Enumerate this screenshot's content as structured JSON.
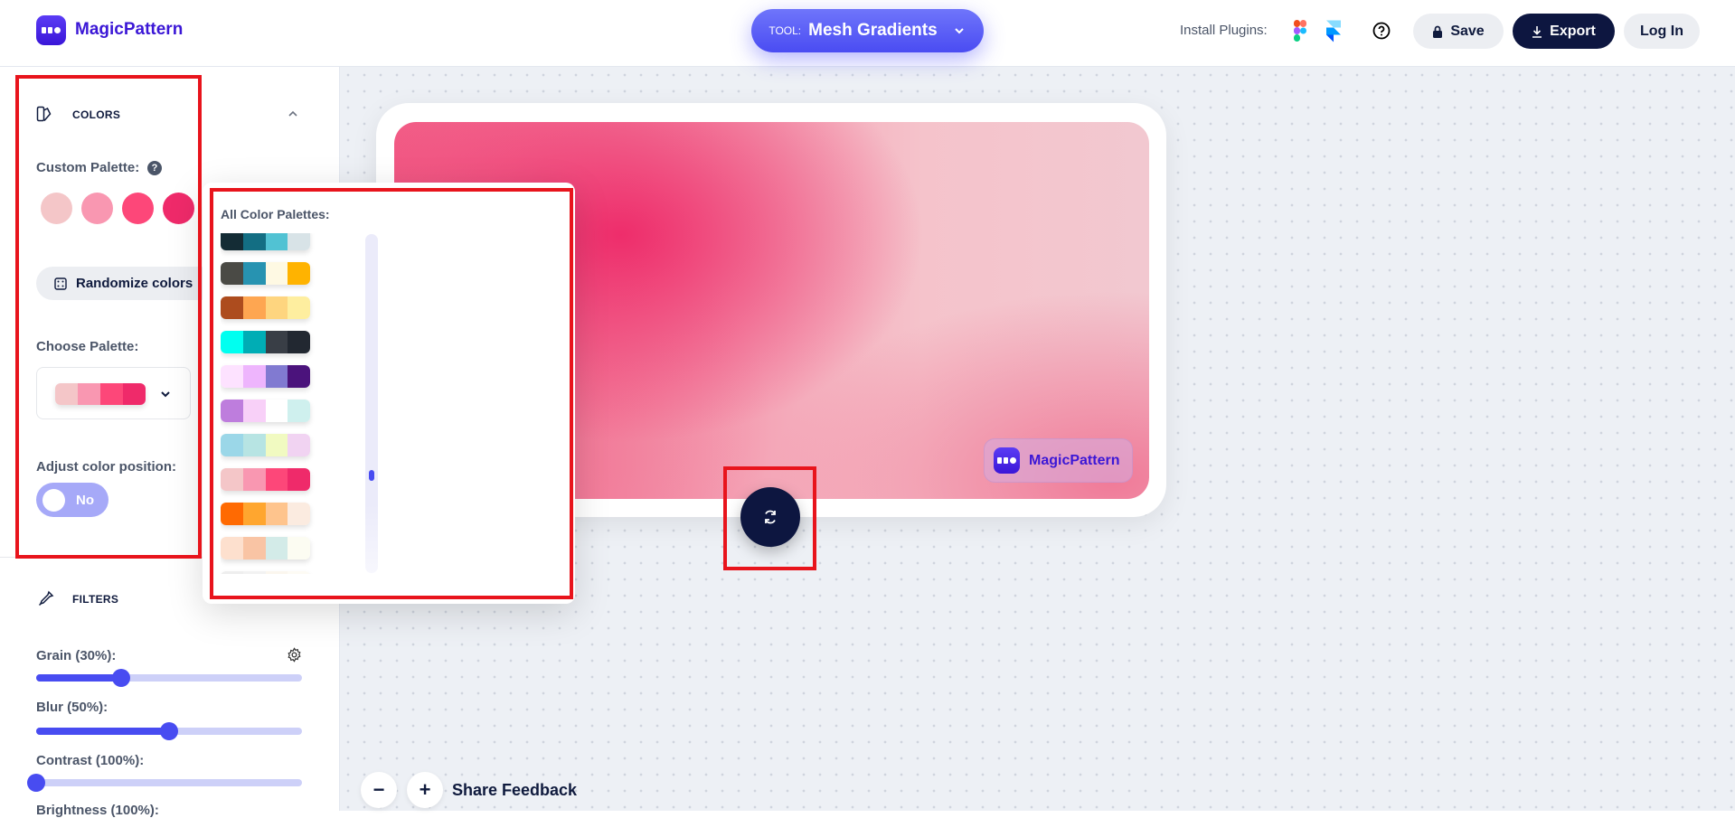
{
  "header": {
    "brand": "MagicPattern",
    "tool_label": "TOOL:",
    "tool_value": "Mesh Gradients",
    "install_plugins": "Install Plugins:",
    "save": "Save",
    "export": "Export",
    "login": "Log In"
  },
  "sidebar": {
    "colors_title": "COLORS",
    "custom_palette": "Custom Palette:",
    "custom_colors": [
      "#f4c6c8",
      "#f997b1",
      "#fd4779",
      "#ef2a6a"
    ],
    "randomize": "Randomize colors",
    "choose_palette": "Choose Palette:",
    "selected_palette": [
      "#f4c6c8",
      "#f997b1",
      "#fd4779",
      "#ef2a6a"
    ],
    "adjust_position": "Adjust color position:",
    "toggle_value": "No",
    "filters_title": "FILTERS",
    "sliders": [
      {
        "label": "Grain (30%):",
        "value": 30
      },
      {
        "label": "Blur (50%):",
        "value": 50
      },
      {
        "label": "Contrast (100%):",
        "value": 100
      },
      {
        "label": "Brightness (100%):",
        "value": 100
      }
    ]
  },
  "popup": {
    "title": "All Color Palettes:",
    "scroll_fraction": 0.72,
    "palettes": [
      [
        "#142c35",
        "#136e83",
        "#51c2d3",
        "#d8e3e7"
      ],
      [
        "#4a4a45",
        "#2793b1",
        "#fef9e3",
        "#ffb300"
      ],
      [
        "#ad4c1e",
        "#fea651",
        "#fed57f",
        "#feee9f"
      ],
      [
        "#00fff0",
        "#00adb5",
        "#393e46",
        "#222831"
      ],
      [
        "#fde2ff",
        "#eeb5fd",
        "#817ad1",
        "#4b137c"
      ],
      [
        "#be7ddd",
        "#f8d0f8",
        "#ffffff",
        "#cff0ee"
      ],
      [
        "#9bd7e8",
        "#b7e4e3",
        "#f1fac1",
        "#f1d3f2"
      ],
      [
        "#f4c6c8",
        "#f997b1",
        "#fd4779",
        "#ef2a6a"
      ],
      [
        "#ff6a02",
        "#ffa62f",
        "#fec48d",
        "#fbebe0"
      ],
      [
        "#fde0ce",
        "#f9c4a4",
        "#d3ebe8",
        "#fcfcf2"
      ],
      [
        "#eeeeee",
        "#f2f2f2",
        "#fbf6ee",
        "#fdfbf4"
      ]
    ]
  },
  "canvas": {
    "badge": "MagicPattern",
    "share_feedback": "Share Feedback"
  }
}
